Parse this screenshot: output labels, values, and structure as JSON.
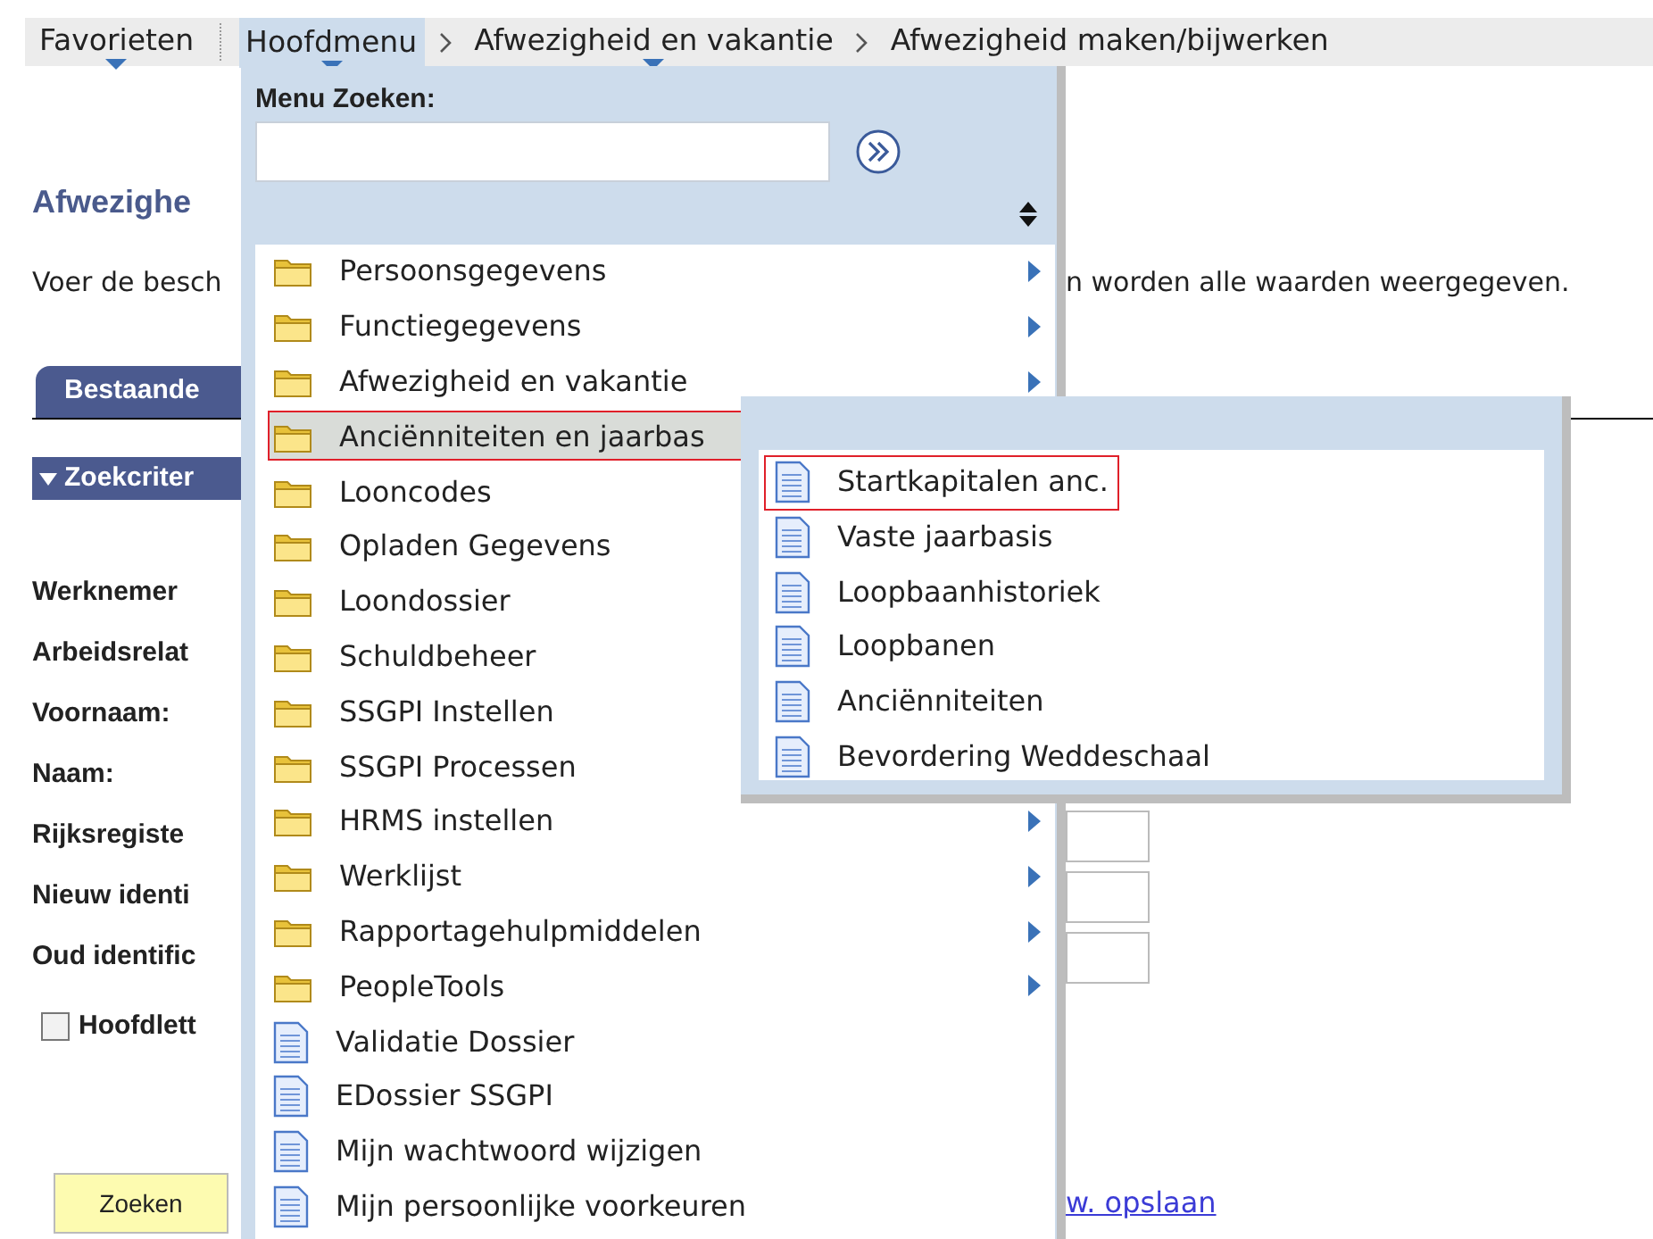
{
  "nav": {
    "items": [
      {
        "label": "Favorieten",
        "kind": "menu",
        "dropdown": true,
        "selected": false
      },
      {
        "label": "Hoofdmenu",
        "kind": "menu",
        "dropdown": true,
        "selected": true
      },
      {
        "label": "Afwezigheid en vakantie",
        "kind": "crumb",
        "dropdown": true,
        "selected": false
      },
      {
        "label": "Afwezigheid maken/bijwerken",
        "kind": "crumb",
        "dropdown": false,
        "selected": false
      }
    ]
  },
  "page": {
    "title": "Afwezighe",
    "instruction_start": "Voer de besch",
    "instruction_end": "n worden alle waarden weergegeven.",
    "tab": "Bestaande",
    "section": "Zoekcriter",
    "fields": [
      {
        "label": "Werknemer",
        "input": false
      },
      {
        "label": "Arbeidsrelat",
        "input": false
      },
      {
        "label": "Voornaam:",
        "input": false
      },
      {
        "label": "Naam:",
        "input": false
      },
      {
        "label": "Rijksregiste",
        "input": true
      },
      {
        "label": "Nieuw identi",
        "input": true
      },
      {
        "label": "Oud identific",
        "input": true
      }
    ],
    "checkbox": {
      "label": "Hoofdlett",
      "checked": false
    },
    "button": "Zoeken",
    "link": "w. opslaan"
  },
  "main_menu": {
    "search_label": "Menu Zoeken:",
    "items": [
      {
        "label": "Persoonsgegevens",
        "kind": "folder",
        "submenu": true,
        "selected": false
      },
      {
        "label": "Functiegegevens",
        "kind": "folder",
        "submenu": true,
        "selected": false
      },
      {
        "label": "Afwezigheid en vakantie",
        "kind": "folder",
        "submenu": true,
        "selected": false
      },
      {
        "label": "Anciënniteiten en jaarbas",
        "kind": "folder",
        "submenu": false,
        "selected": true
      },
      {
        "label": "Looncodes",
        "kind": "folder",
        "submenu": false,
        "selected": false
      },
      {
        "label": "Opladen Gegevens",
        "kind": "folder",
        "submenu": false,
        "selected": false
      },
      {
        "label": "Loondossier",
        "kind": "folder",
        "submenu": false,
        "selected": false
      },
      {
        "label": "Schuldbeheer",
        "kind": "folder",
        "submenu": false,
        "selected": false
      },
      {
        "label": "SSGPI Instellen",
        "kind": "folder",
        "submenu": false,
        "selected": false
      },
      {
        "label": "SSGPI Processen",
        "kind": "folder",
        "submenu": false,
        "selected": false
      },
      {
        "label": "HRMS instellen",
        "kind": "folder",
        "submenu": true,
        "selected": false
      },
      {
        "label": "Werklijst",
        "kind": "folder",
        "submenu": true,
        "selected": false
      },
      {
        "label": "Rapportagehulpmiddelen",
        "kind": "folder",
        "submenu": true,
        "selected": false
      },
      {
        "label": "PeopleTools",
        "kind": "folder",
        "submenu": true,
        "selected": false
      },
      {
        "label": "Validatie Dossier",
        "kind": "page",
        "submenu": false,
        "selected": false
      },
      {
        "label": "EDossier SSGPI",
        "kind": "page",
        "submenu": false,
        "selected": false
      },
      {
        "label": "Mijn wachtwoord wijzigen",
        "kind": "page",
        "submenu": false,
        "selected": false
      },
      {
        "label": "Mijn persoonlijke voorkeuren",
        "kind": "page",
        "submenu": false,
        "selected": false
      }
    ]
  },
  "sub_menu": {
    "items": [
      {
        "label": "Startkapitalen anc.",
        "kind": "page",
        "selected": true
      },
      {
        "label": "Vaste jaarbasis",
        "kind": "page",
        "selected": false
      },
      {
        "label": "Loopbaanhistoriek",
        "kind": "page",
        "selected": false
      },
      {
        "label": "Loopbanen",
        "kind": "page",
        "selected": false
      },
      {
        "label": "Anciënniteiten",
        "kind": "page",
        "selected": false
      },
      {
        "label": "Bevordering Weddeschaal",
        "kind": "page",
        "selected": false
      }
    ]
  }
}
